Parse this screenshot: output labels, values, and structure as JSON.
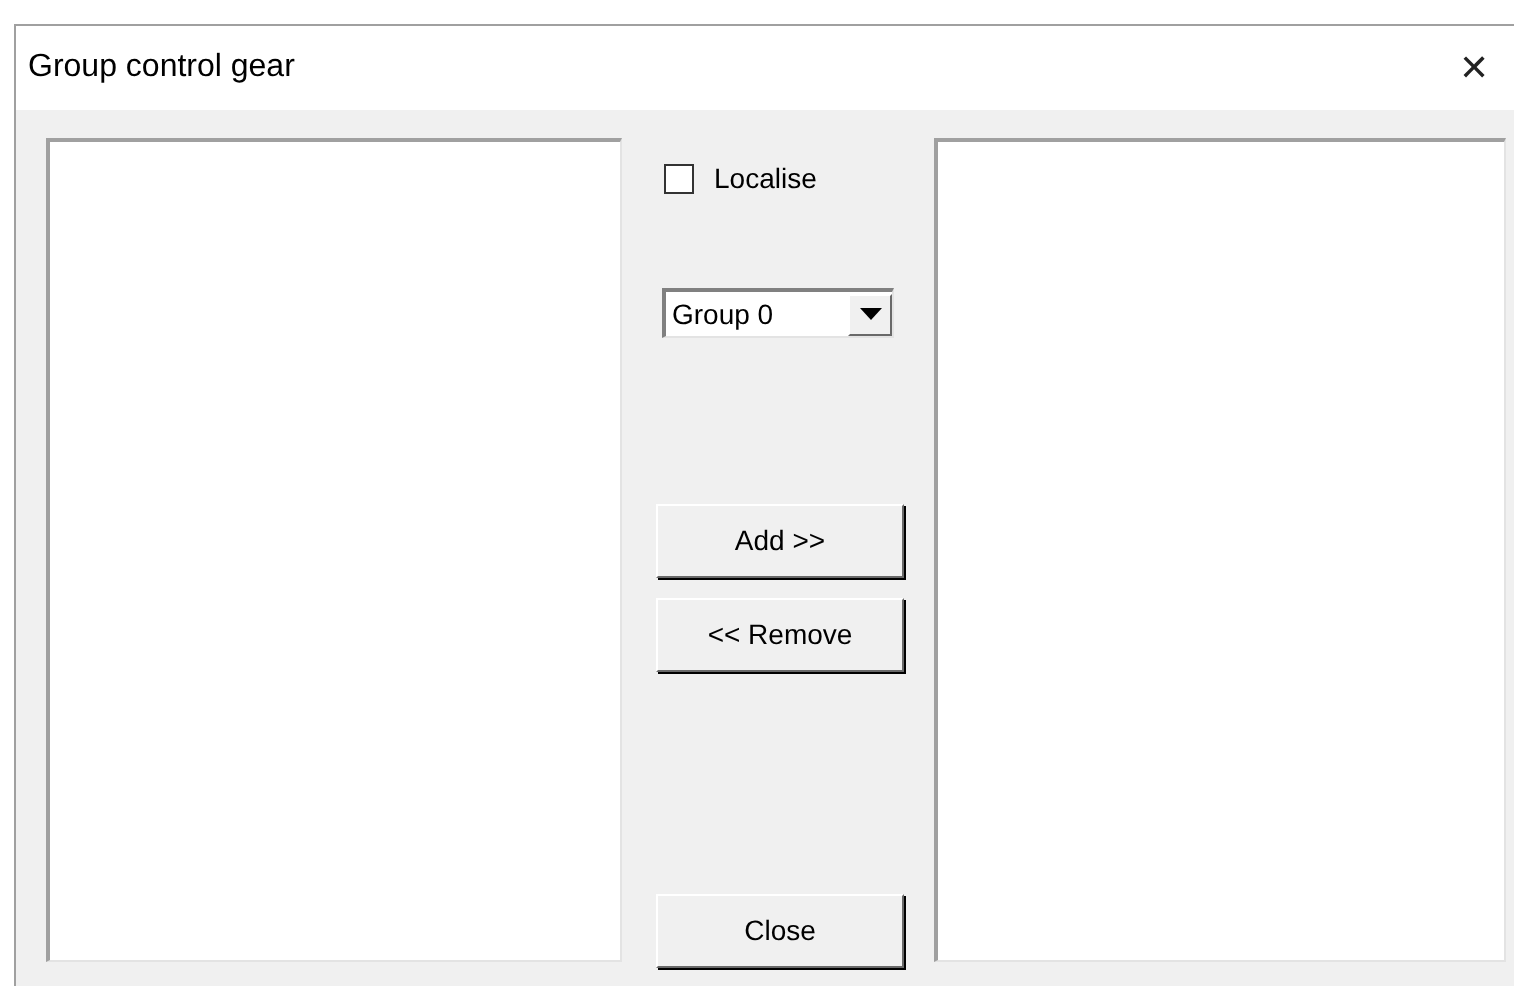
{
  "window": {
    "title": "Group control gear",
    "close_glyph": "✕"
  },
  "localise": {
    "label": "Localise",
    "checked": false
  },
  "group_select": {
    "value": "Group 0"
  },
  "buttons": [
    {
      "label": "Add >>"
    },
    {
      "label": "<< Remove"
    }
  ],
  "close_button": {
    "label": "Close"
  }
}
